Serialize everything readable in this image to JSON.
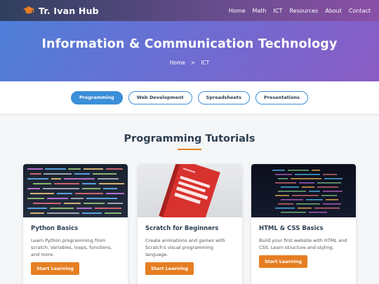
{
  "navbar": {
    "brand": "Tr. Ivan Hub",
    "brand_icon": "graduation-cap-icon",
    "links": [
      "Home",
      "Math",
      "ICT",
      "Resources",
      "About",
      "Contact"
    ]
  },
  "hero": {
    "title": "Information & Communication Technology",
    "breadcrumb": {
      "home": "Home",
      "separator": ">",
      "current": "ICT"
    }
  },
  "filters": {
    "items": [
      "Programming",
      "Web Development",
      "Spreadsheets",
      "Presentations"
    ],
    "active": "Programming"
  },
  "section": {
    "title": "Programming Tutorials"
  },
  "cards": [
    {
      "title": "Python Basics",
      "description": "Learn Python programming from scratch. Variables, loops, functions, and more.",
      "button": "Start Learning",
      "image": "code-screen-image"
    },
    {
      "title": "Scratch for Beginners",
      "description": "Create animations and games with Scratch's visual programming language.",
      "button": "Start Learning",
      "image": "javascript-book-image"
    },
    {
      "title": "HTML & CSS Basics",
      "description": "Build your first website with HTML and CSS. Learn structure and styling.",
      "button": "Start Learning",
      "image": "html-code-image"
    }
  ],
  "colors": {
    "accent": "#e67e22",
    "primary": "#3b8ed8",
    "heading": "#2c3e50"
  }
}
